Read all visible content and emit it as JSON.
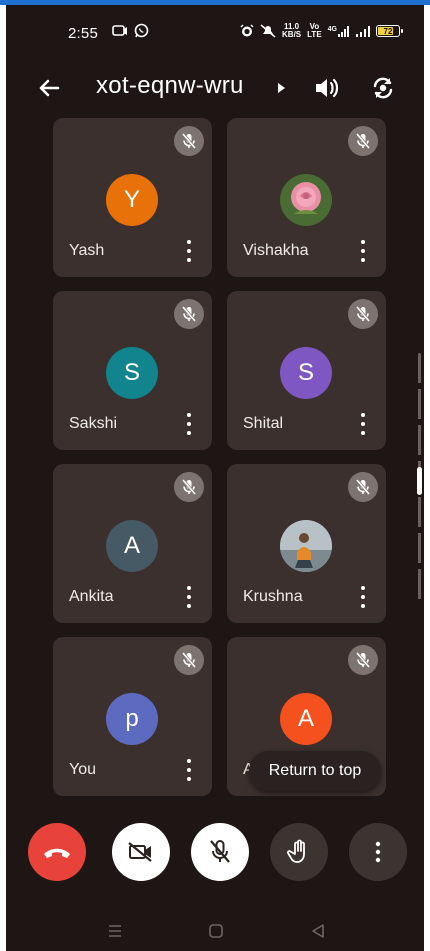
{
  "status_bar": {
    "time": "2:55",
    "net_speed_value": "11.0",
    "net_speed_unit": "KB/S",
    "volte_top": "Vo",
    "volte_bottom": "LTE",
    "signal_label": "4G",
    "battery": "72"
  },
  "header": {
    "meeting_code": "xot-eqnw-wru"
  },
  "participants": [
    {
      "name": "Yash",
      "initial": "Y",
      "avatar_color": "#e8710a",
      "avatar_type": "initial"
    },
    {
      "name": "Vishakha",
      "initial": "",
      "avatar_color": "#d8a4b0",
      "avatar_type": "photo-rose"
    },
    {
      "name": "Sakshi",
      "initial": "S",
      "avatar_color": "#12848e",
      "avatar_type": "initial"
    },
    {
      "name": "Shital",
      "initial": "S",
      "avatar_color": "#7e57c2",
      "avatar_type": "initial"
    },
    {
      "name": "Ankita",
      "initial": "A",
      "avatar_color": "#455a64",
      "avatar_type": "initial"
    },
    {
      "name": "Krushna",
      "initial": "",
      "avatar_color": "#8a9aa6",
      "avatar_type": "photo-person"
    },
    {
      "name": "You",
      "initial": "p",
      "avatar_color": "#5c6bc0",
      "avatar_type": "initial"
    },
    {
      "name": "A",
      "initial": "A",
      "avatar_color": "#f4511e",
      "avatar_type": "initial"
    }
  ],
  "return_to_top_label": "Return to top",
  "controls": {
    "end_call_color": "#e8433a",
    "video_off_color": "#ffffff",
    "mic_off_color": "#ffffff",
    "raise_hand_color": "#3c3431",
    "more_color": "#3c3431"
  },
  "icons": [
    "back-arrow-icon",
    "cast-icon",
    "speaker-icon",
    "switch-camera-icon",
    "mic-off-icon",
    "more-vert-icon",
    "end-call-icon",
    "video-off-icon",
    "raise-hand-icon"
  ]
}
